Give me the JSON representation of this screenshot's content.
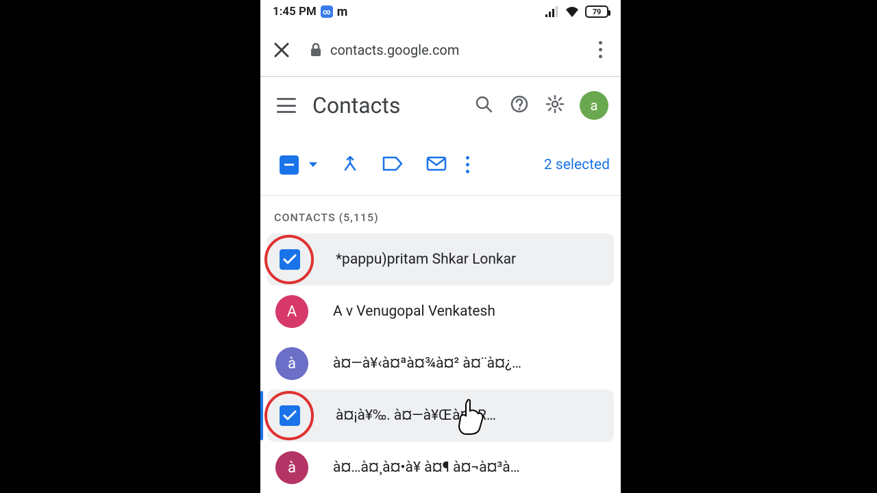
{
  "statusbar": {
    "time": "1:45 PM",
    "battery": "79"
  },
  "browser": {
    "url": "contacts.google.com"
  },
  "header": {
    "title": "Contacts",
    "avatar_letter": "a"
  },
  "toolbar": {
    "selected_text": "2 selected"
  },
  "section_label": "CONTACTS (5,115)",
  "contacts": [
    {
      "name": "*pappu)pritam Shkar Lonkar",
      "selected": true
    },
    {
      "name": "A v Venugopal Venkatesh",
      "selected": false,
      "avatar_letter": "A",
      "avatar_color": "#d6396a"
    },
    {
      "name": "à¤—à¥‹à¤ªà¤¾à¤² à¤¨à¤¿…",
      "selected": false,
      "avatar_letter": "à",
      "avatar_color": "#6b6fc7"
    },
    {
      "name": "à¤¡à¥‰. à¤—à¥Œà¤    R…",
      "selected": true
    },
    {
      "name": "à¤…à¤¸à¤•à¥ à¤¶ à¤¬à¤³à…",
      "selected": false,
      "avatar_letter": "à",
      "avatar_color": "#b33465"
    }
  ]
}
